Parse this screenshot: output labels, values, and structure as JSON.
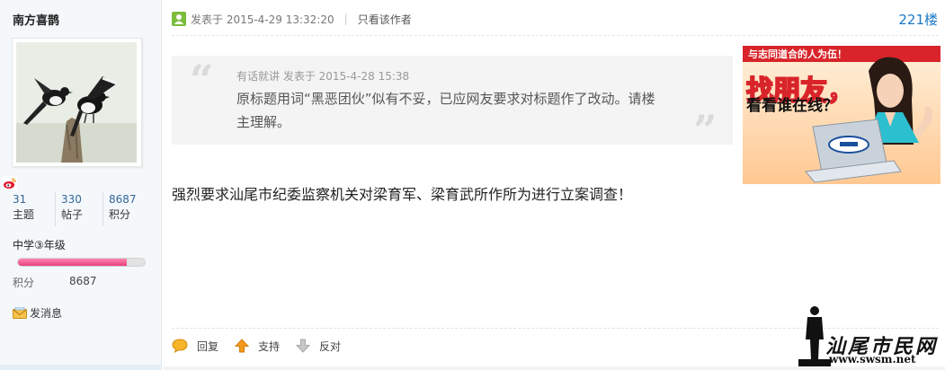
{
  "user": {
    "name": "南方喜鹊",
    "stats": [
      {
        "value": "31",
        "label": "主题"
      },
      {
        "value": "330",
        "label": "帖子"
      },
      {
        "value": "8687",
        "label": "积分"
      }
    ],
    "level": "中学③年级",
    "level_progress": 0.86,
    "points_label": "积分",
    "points_value": "8687",
    "send_message": "发消息"
  },
  "post": {
    "posted_at": "发表于 2015-4-29 13:32:20",
    "separator": "|",
    "author_only": "只看该作者",
    "floor": "221楼",
    "quote": {
      "author": "有话就讲",
      "posted_at": "发表于 2015-4-28 15:38",
      "text": "原标题用词“黑恶团伙”似有不妥，已应网友要求对标题作了改动。请楼主理解。"
    },
    "body": "强烈要求汕尾市纪委监察机关对梁育军、梁育武所作所为进行立案调查！",
    "actions": {
      "reply": "回复",
      "support": "支持",
      "oppose": "反对"
    }
  },
  "ad": {
    "line1": "与志同道合的人为伍！",
    "line2": "找朋友，",
    "line3": "看看谁在线？"
  },
  "watermark": {
    "title": "汕尾市民网",
    "url": "www.swsm.net"
  },
  "colors": {
    "sidebar_bg": "#f4f8fb",
    "floor_link": "#1a78c8",
    "progress_fill": "#e8407a",
    "ad_bg": "#ffd9b3"
  }
}
